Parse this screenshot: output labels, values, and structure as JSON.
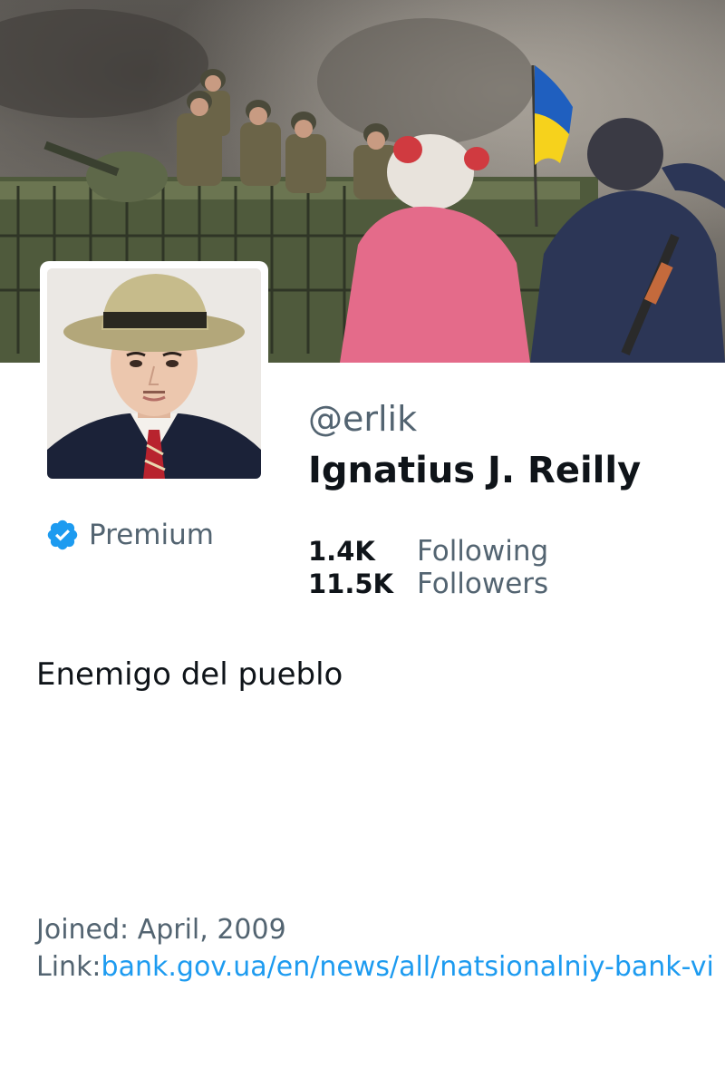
{
  "profile": {
    "handle": "@erlik",
    "display_name": "Ignatius J. Reilly",
    "premium_label": "Premium",
    "bio": "Enemigo del pueblo"
  },
  "stats": [
    {
      "value": "1.4K",
      "label": "Following"
    },
    {
      "value": "11.5K",
      "label": "Followers"
    }
  ],
  "meta": {
    "joined": "Joined: April, 2009",
    "link_prefix": "Link:",
    "link_url": "bank.gov.ua/en/news/all/natsionalniy-bank-vi"
  },
  "icons": {
    "verified": "verified-badge-icon"
  },
  "colors": {
    "accent": "#1d9bf0",
    "secondary_text": "#536471",
    "primary_text": "#0f1419",
    "flag_blue": "#1f5fbf",
    "flag_yellow": "#f6d21c"
  }
}
